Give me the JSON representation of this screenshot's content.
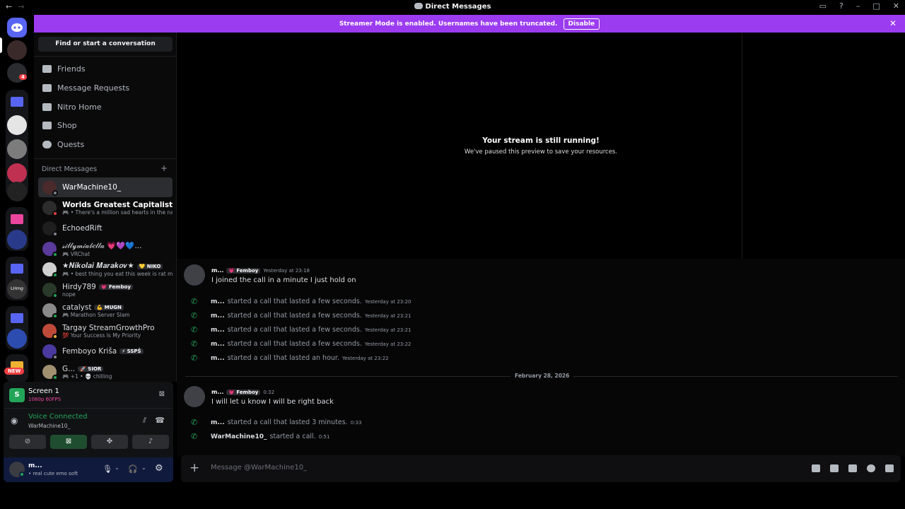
{
  "window": {
    "title": "Direct Messages",
    "back_icon": "←",
    "forward_icon": "→"
  },
  "banner": {
    "text": "Streamer Mode is enabled. Usernames have been truncated.",
    "button": "Disable"
  },
  "servers": {
    "badge": "4",
    "new_label": "NEW",
    "lhmg_label": "·LHmg·"
  },
  "sidebar": {
    "find_placeholder": "Find or start a conversation",
    "nav": [
      {
        "label": "Friends"
      },
      {
        "label": "Message Requests"
      },
      {
        "label": "Nitro Home"
      },
      {
        "label": "Shop"
      },
      {
        "label": "Quests"
      }
    ],
    "dm_header": "Direct Messages",
    "dms": [
      {
        "name": "WarMachine10_",
        "sub": "",
        "tag": ""
      },
      {
        "name": "Worlds Greatest Capitalist...",
        "sub": "🎮 • There's a million sad hearts in the nation",
        "tag": ""
      },
      {
        "name": "EchoedRift",
        "sub": "",
        "tag": ""
      },
      {
        "name": "𝓈𝒾𝓁𝓁𝓎𝓂𝒾𝒶𝒷𝑒𝓁𝓁𝒶 💗💜💙...",
        "sub": "🎮 VRChat",
        "tag": ""
      },
      {
        "name": "★𝑵𝒊𝒌𝒐𝒍𝒂𝒊 𝑴𝒂𝒓𝒂𝒌𝒐𝒗★",
        "sub": "🎮 • best thing you eat this week is rat meat",
        "tag": "💛 NIKO"
      },
      {
        "name": "Hirdy789",
        "sub": "nope",
        "tag": "💗 Femboy"
      },
      {
        "name": "catalyst",
        "sub": "🎮 Marathon Server Slam",
        "tag": "💪 MUGN"
      },
      {
        "name": "Targay StreamGrowthPro",
        "sub": "💯 Your Success Is My Priority",
        "tag": ""
      },
      {
        "name": "Femboyo Kriša",
        "sub": "",
        "tag": "⚡ SSPŠ"
      },
      {
        "name": "G...",
        "sub": "🎮 +1 • 💀 chilling",
        "tag": "🚀 SIOR"
      }
    ]
  },
  "panel": {
    "screen_title": "Screen 1",
    "screen_quality": "1080p 60FPS",
    "voice_status": "Voice Connected",
    "voice_channel": "WarMachine10_"
  },
  "user": {
    "name": "m...",
    "status": "• real cute emo soft"
  },
  "stream": {
    "title": "Your stream is still running!",
    "subtitle": "We've paused this preview to save your resources."
  },
  "messages": {
    "first": {
      "author": "m...",
      "tag": "💗 Femboy",
      "time": "Yesterday at 23:18",
      "text": "I joined the call in a minute I just hold on"
    },
    "calls1": [
      {
        "who": "m...",
        "text": "started a call that lasted a few seconds.",
        "time": "Yesterday at 23:20"
      },
      {
        "who": "m...",
        "text": "started a call that lasted a few seconds.",
        "time": "Yesterday at 23:21"
      },
      {
        "who": "m...",
        "text": "started a call that lasted a few seconds.",
        "time": "Yesterday at 23:21"
      },
      {
        "who": "m...",
        "text": "started a call that lasted a few seconds.",
        "time": "Yesterday at 23:22"
      },
      {
        "who": "m...",
        "text": "started a call that lasted an hour.",
        "time": "Yesterday at 23:22"
      }
    ],
    "date_divider": "February 28, 2026",
    "second": {
      "author": "m...",
      "tag": "💗 Femboy",
      "time": "0:32",
      "text": "I will let u know I will be right back"
    },
    "calls2": [
      {
        "who": "m...",
        "text": "started a call that lasted 3 minutes.",
        "time": "0:33"
      },
      {
        "who": "WarMachine10_",
        "text": "started a call.",
        "time": "0:51"
      }
    ]
  },
  "composer": {
    "placeholder": "Message @WarMachine10_"
  },
  "colors": {
    "banner": "#9b3cf0",
    "online": "#23a559",
    "brand": "#5865f2"
  }
}
